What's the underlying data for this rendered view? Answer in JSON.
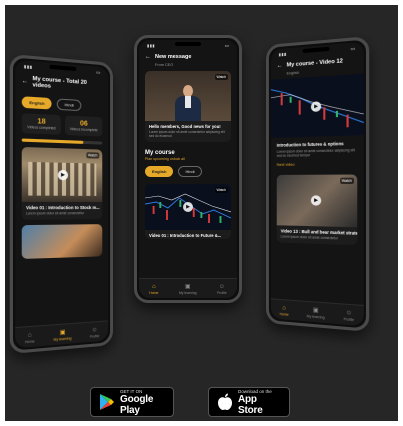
{
  "colors": {
    "accent": "#e6a92a",
    "bg": "#262626",
    "card": "#1c1c1c"
  },
  "phone_left": {
    "title": "My course - Total 20 videos",
    "seg": {
      "a": "English",
      "b": "Hindi"
    },
    "stats": [
      {
        "num": "18",
        "label": "Videos completed"
      },
      {
        "num": "06",
        "label": "Videos Incomplete"
      }
    ],
    "progress": 0.75,
    "cards": [
      {
        "title": "Video 01 : Introduction to Stock m...",
        "desc": "Lorem ipsum dolor sit amet consectetur",
        "badge": "Watch"
      }
    ],
    "tabs": [
      {
        "label": "Home",
        "icon": "home-icon"
      },
      {
        "label": "My learning",
        "icon": "book-icon"
      },
      {
        "label": "Profile",
        "icon": "user-icon"
      }
    ]
  },
  "phone_mid": {
    "title": "New message",
    "subtitle": "From CEO",
    "msg": {
      "title": "Hello members, Good news for you!",
      "desc": "Lorem ipsum dolor sit amet consectetur adipiscing elit sed do eiusmod",
      "badge": "Watch"
    },
    "section": "My course",
    "section_sub": "Plan upcoming unlock all",
    "seg": {
      "a": "English",
      "b": "Hindi"
    },
    "card": {
      "title": "Video 01 : Introduction to Future &...",
      "badge": "Watch"
    },
    "tabs": [
      {
        "label": "Home",
        "icon": "home-icon"
      },
      {
        "label": "My learning",
        "icon": "book-icon"
      },
      {
        "label": "Profile",
        "icon": "user-icon"
      }
    ]
  },
  "phone_right": {
    "title": "My course - Video 12",
    "subtitle": "English",
    "card1": {
      "title": "Introduction to futures & options",
      "desc": "Lorem ipsum dolor sit amet consectetur adipiscing elit sed do eiusmod tempor"
    },
    "link": "Next video",
    "card2": {
      "title": "Video 13 : Bull and bear market strateg...",
      "desc": "Lorem ipsum dolor sit amet consectetur",
      "badge": "Watch"
    },
    "tabs": [
      {
        "label": "Home",
        "icon": "home-icon"
      },
      {
        "label": "My learning",
        "icon": "book-icon"
      },
      {
        "label": "Profile",
        "icon": "user-icon"
      }
    ]
  },
  "stores": {
    "google": {
      "small": "GET IT ON",
      "big": "Google Play"
    },
    "apple": {
      "small": "Download on the",
      "big": "App Store"
    }
  }
}
